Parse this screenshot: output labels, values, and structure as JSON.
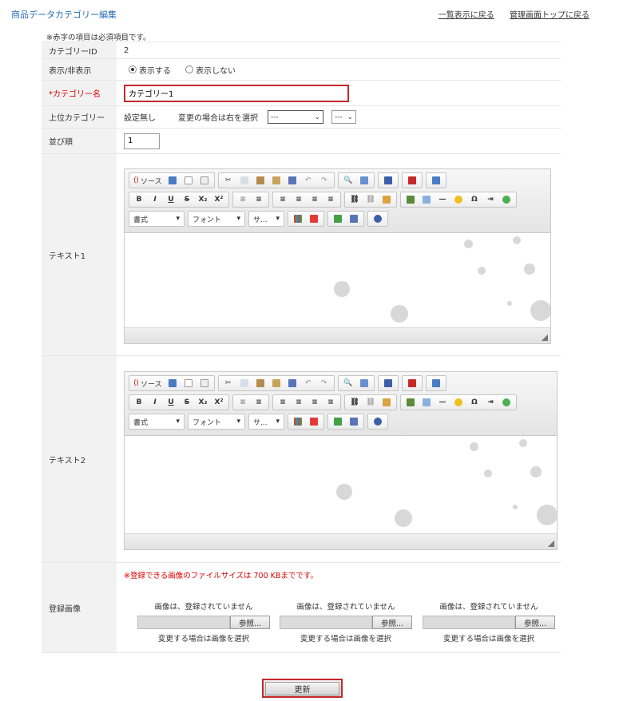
{
  "header": {
    "title": "商品データカテゴリー編集",
    "link_list": "一覧表示に戻る",
    "link_top": "管理画面トップに戻る"
  },
  "note": "※赤字の項目は必須項目です。",
  "rows": {
    "category_id": {
      "label": "カテゴリーID",
      "value": "2"
    },
    "visibility": {
      "label": "表示/非表示",
      "options": [
        "表示する",
        "表示しない"
      ],
      "selected": "表示する"
    },
    "category_name": {
      "label": "*カテゴリー名",
      "value": "カテゴリー1"
    },
    "parent": {
      "label": "上位カテゴリー",
      "current": "設定無し",
      "hint": "変更の場合は右を選択",
      "select1": "---",
      "select2": "---"
    },
    "order": {
      "label": "並び順",
      "value": "1"
    },
    "text1": {
      "label": "テキスト1"
    },
    "text2": {
      "label": "テキスト2"
    },
    "images": {
      "label": "登録画像",
      "warning": "※登録できる画像のファイルサイズは 700 KBまでです。",
      "slots": [
        {
          "status": "画像は、登録されていません",
          "button": "参照...",
          "hint": "変更する場合は画像を選択"
        },
        {
          "status": "画像は、登録されていません",
          "button": "参照...",
          "hint": "変更する場合は画像を選択"
        },
        {
          "status": "画像は、登録されていません",
          "button": "参照...",
          "hint": "変更する場合は画像を選択"
        }
      ]
    }
  },
  "editor": {
    "source_label": "ソース",
    "format": "書式",
    "font": "フォント",
    "size": "サ...",
    "bold": "B",
    "italic": "I",
    "underline": "U",
    "strike": "S",
    "sub": "X₂",
    "sup": "X²",
    "omega": "Ω"
  },
  "submit": "更新",
  "colors": {
    "accent": "#2a6db5",
    "required": "#dd0000",
    "focus_border": "#c62828"
  }
}
